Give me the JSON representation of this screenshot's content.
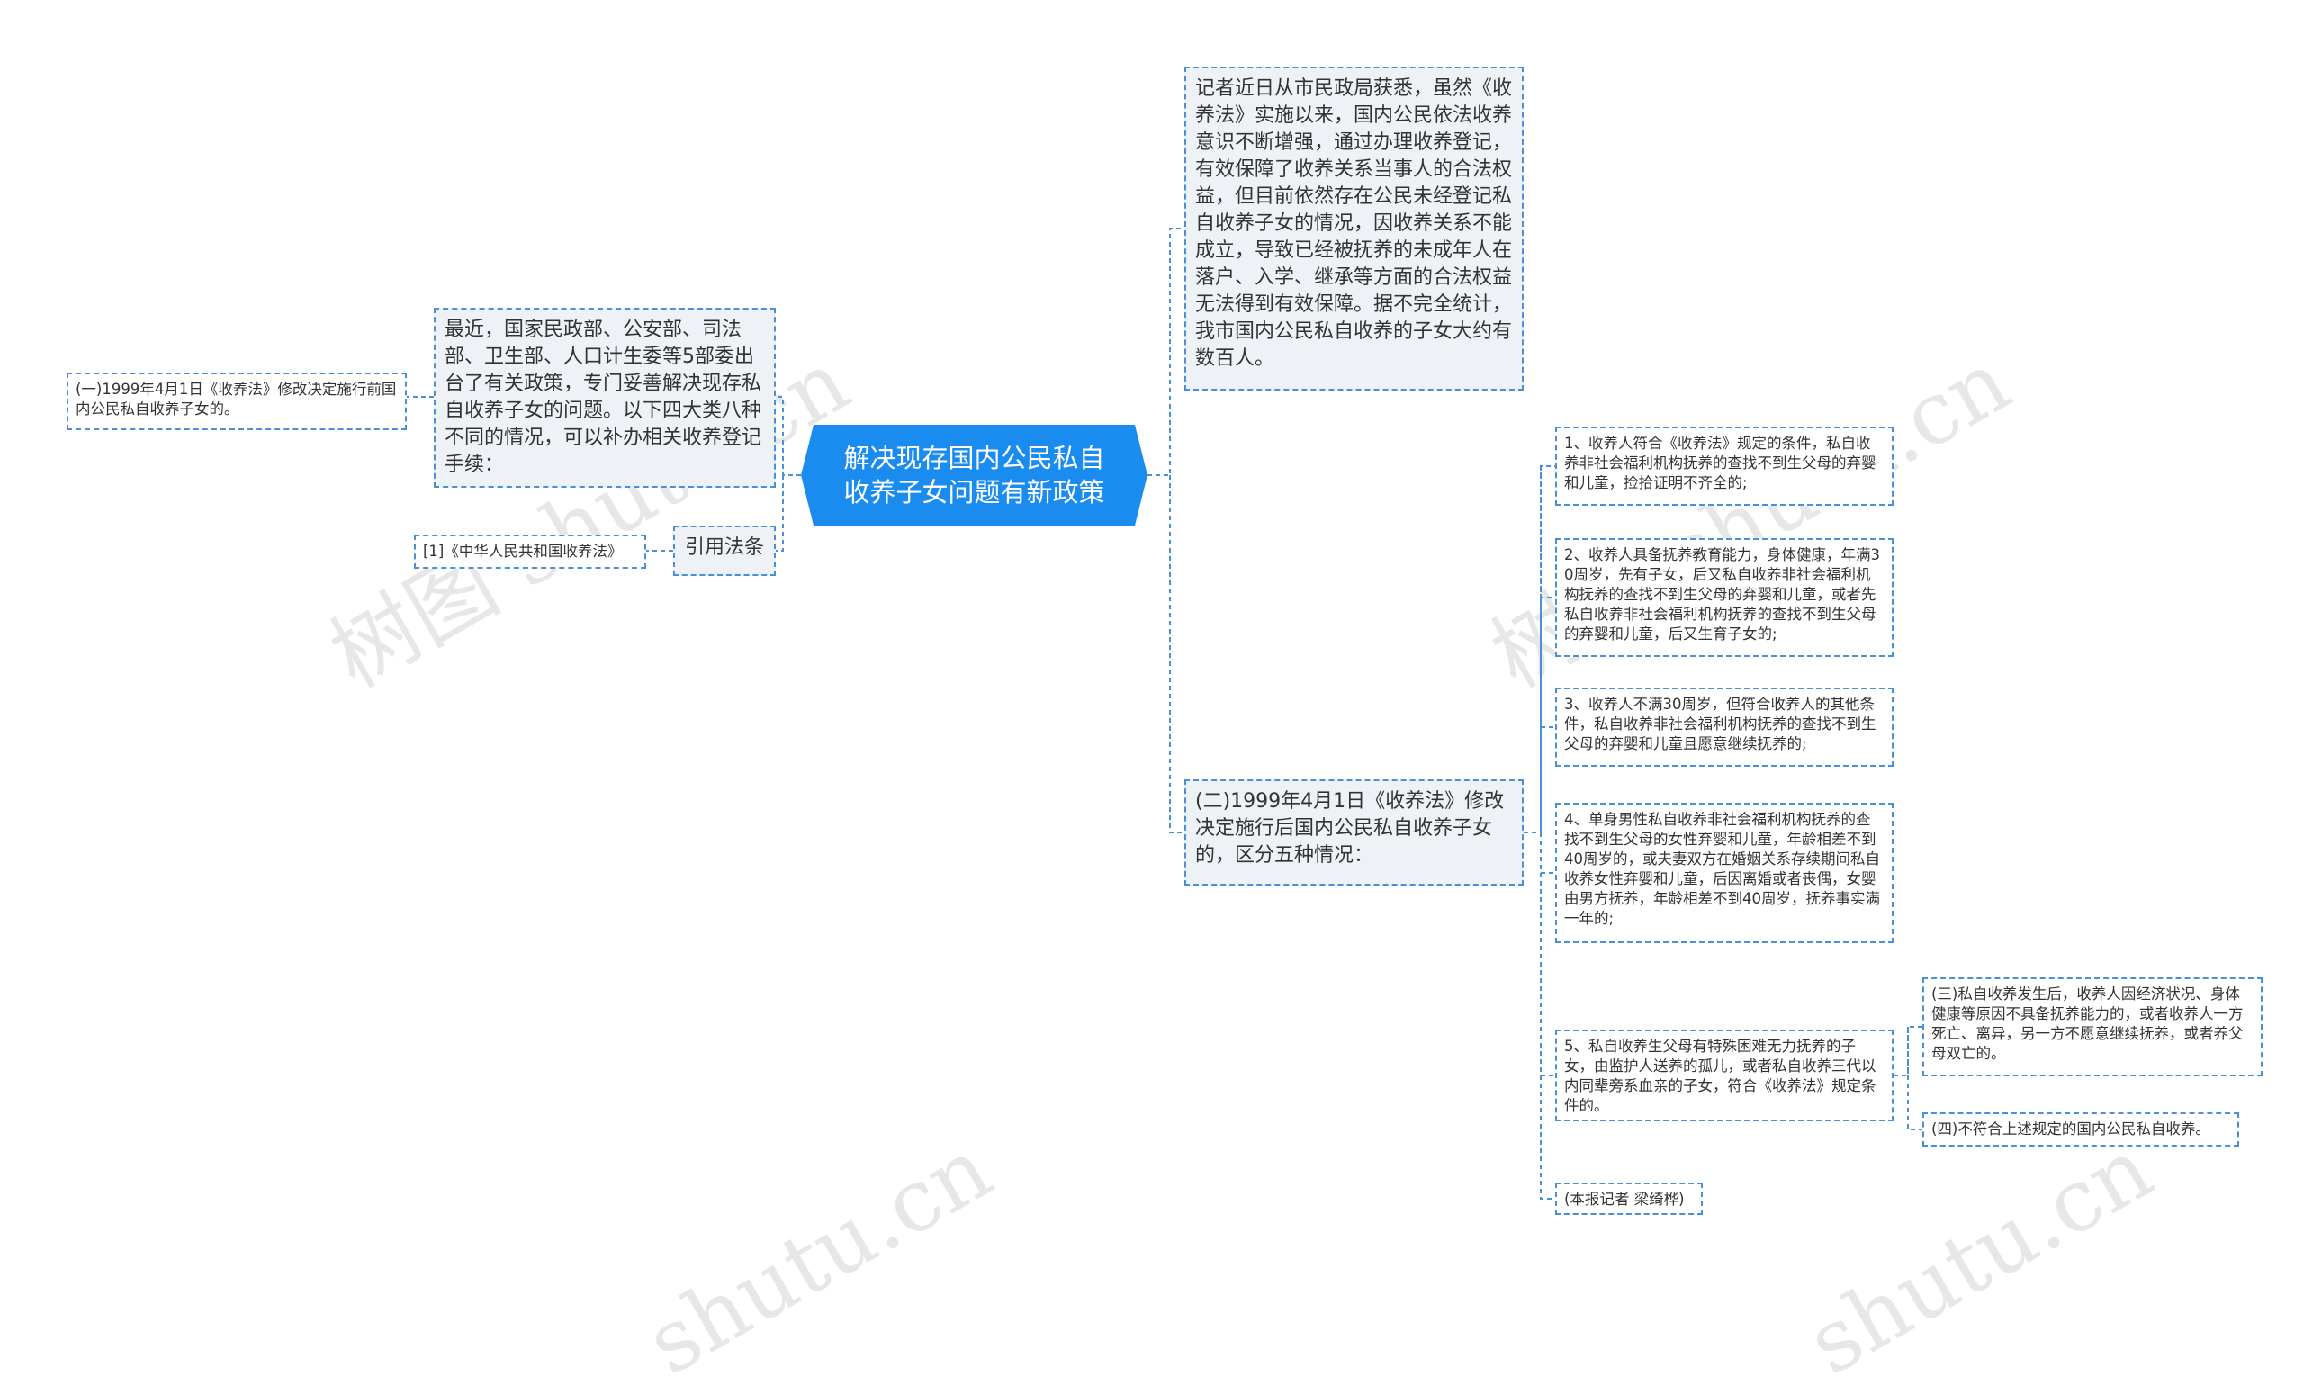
{
  "root": {
    "label": "解决现存国内公民私自收养子女问题有新政策"
  },
  "right": {
    "intro": "记者近日从市民政局获悉，虽然《收养法》实施以来，国内公民依法收养意识不断增强，通过办理收养登记，有效保障了收养关系当事人的合法权益，但目前依然存在公民未经登记私自收养子女的情况，因收养关系不能成立，导致已经被抚养的未成年人在落户、入学、继承等方面的合法权益无法得到有效保障。据不完全统计，我市国内公民私自收养的子女大约有数百人。",
    "section2": "(二)1999年4月1日《收养法》修改决定施行后国内公民私自收养子女的，区分五种情况：",
    "items": [
      "1、收养人符合《收养法》规定的条件，私自收养非社会福利机构抚养的查找不到生父母的弃婴和儿童，捡拾证明不齐全的;",
      "2、收养人具备抚养教育能力，身体健康，年满30周岁，先有子女，后又私自收养非社会福利机构抚养的查找不到生父母的弃婴和儿童，或者先私自收养非社会福利机构抚养的查找不到生父母的弃婴和儿童，后又生育子女的;",
      "3、收养人不满30周岁，但符合收养人的其他条件，私自收养非社会福利机构抚养的查找不到生父母的弃婴和儿童且愿意继续抚养的;",
      "4、单身男性私自收养非社会福利机构抚养的查找不到生父母的女性弃婴和儿童，年龄相差不到40周岁的，或夫妻双方在婚姻关系存续期间私自收养女性弃婴和儿童，后因离婚或者丧偶，女婴由男方抚养，年龄相差不到40周岁，抚养事实满一年的;",
      "5、私自收养生父母有特殊困难无力抚养的子女，由监护人送养的孤儿，或者私自收养三代以内同辈旁系血亲的子女，符合《收养法》规定条件的。"
    ],
    "reporter": "(本报记者 梁绮桦)",
    "section3": "(三)私自收养发生后，收养人因经济状况、身体健康等原因不具备抚养能力的，或者收养人一方死亡、离异，另一方不愿意继续抚养，或者养父母双亡的。",
    "section4": "(四)不符合上述规定的国内公民私自收养。"
  },
  "left": {
    "intro": "最近，国家民政部、公安部、司法部、卫生部、人口计生委等5部委出台了有关政策，专门妥善解决现存私自收养子女的问题。以下四大类八种不同的情况，可以补办相关收养登记手续：",
    "section1": "(一)1999年4月1日《收养法》修改决定施行前国内公民私自收养子女的。",
    "citation_label": "引用法条",
    "citation_ref": "[1]《中华人民共和国收养法》"
  },
  "watermarks": [
    "树图 shutu.cn",
    "树图 shutu.cn",
    "shutu.cn",
    "shutu.cn"
  ],
  "colors": {
    "root": "#1a8cf0",
    "border": "#4a90d9",
    "shade": "#eef1f5",
    "line": "#4a90d9"
  }
}
